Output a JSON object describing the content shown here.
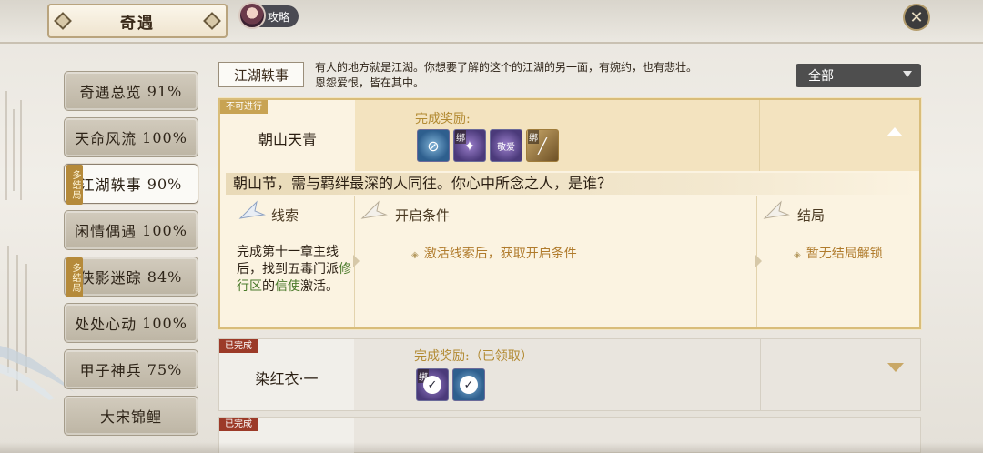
{
  "header": {
    "title": "奇遇",
    "guide_label": "攻略"
  },
  "sidebar": {
    "items": [
      {
        "label": "奇遇总览",
        "percent": "91%",
        "tag": ""
      },
      {
        "label": "天命风流",
        "percent": "100%",
        "tag": ""
      },
      {
        "label": "江湖轶事",
        "percent": "90%",
        "tag": "多结局"
      },
      {
        "label": "闲情偶遇",
        "percent": "100%",
        "tag": ""
      },
      {
        "label": "侠影迷踪",
        "percent": "84%",
        "tag": "多结局"
      },
      {
        "label": "处处心动",
        "percent": "100%",
        "tag": ""
      },
      {
        "label": "甲子神兵",
        "percent": "75%",
        "tag": ""
      },
      {
        "label": "大宋锦鲤",
        "percent": "",
        "tag": ""
      }
    ],
    "active_index": 2
  },
  "section": {
    "label": "江湖轶事",
    "description": "有人的地方就是江湖。你想要了解的这个的江湖的另一面，有婉约，也有悲壮。恩怨爱恨，皆在其中。"
  },
  "filter": {
    "value": "全部"
  },
  "cards": [
    {
      "status": "不可进行",
      "name": "朝山天青",
      "reward_label": "完成奖励:",
      "rewards": [
        {
          "style": "blue",
          "bind": "",
          "icon": "swirl-icon"
        },
        {
          "style": "purple",
          "bind": "绑",
          "icon": "scroll-icon"
        },
        {
          "style": "purple",
          "bind": "",
          "icon": "book-icon",
          "text": "敬爱"
        },
        {
          "style": "gold",
          "bind": "绑",
          "icon": "feather-icon"
        }
      ],
      "question": "朝山节，需与羁绊最深的人同往。你心中所念之人，是谁？",
      "clue_title": "线索",
      "clue_text_a": "完成第十一章主线后，找到五毒门派",
      "clue_text_green_a": "修行区",
      "clue_text_b": "的",
      "clue_text_green_b": "信使",
      "clue_text_c": "激活。",
      "condition_title": "开启条件",
      "condition_text": "激活线索后，获取开启条件",
      "ending_title": "结局",
      "ending_text": "暂无结局解锁"
    },
    {
      "status": "已完成",
      "name": "染红衣·一",
      "reward_label": "完成奖励:（已领取）",
      "rewards": [
        {
          "style": "purple",
          "bind": "绑",
          "icon": "check-icon"
        },
        {
          "style": "blue",
          "bind": "",
          "icon": "check-icon"
        }
      ]
    },
    {
      "status": "已完成"
    }
  ],
  "colors": {
    "accent_gold": "#b28a32",
    "tag_done": "#9c3a28",
    "tag_unavailable": "#c8a353",
    "clue_green": "#4a7a2a"
  }
}
